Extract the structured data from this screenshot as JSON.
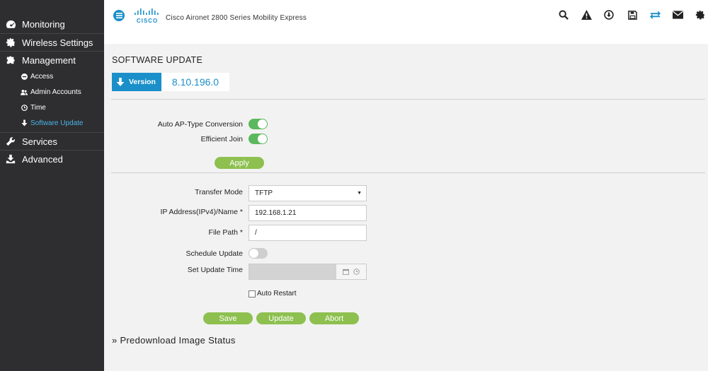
{
  "header": {
    "app_title": "Cisco Aironet 2800 Series Mobility Express",
    "logo_text": "CISCO",
    "icons": [
      "search-icon",
      "alert-icon",
      "download-icon",
      "save-icon",
      "transfer-icon",
      "mail-icon",
      "gear-icon"
    ]
  },
  "sidebar": {
    "items": [
      {
        "label": "Monitoring",
        "icon": "dashboard-icon"
      },
      {
        "label": "Wireless Settings",
        "icon": "gear-icon"
      },
      {
        "label": "Management",
        "icon": "puzzle-icon"
      },
      {
        "label": "Services",
        "icon": "wrench-icon"
      },
      {
        "label": "Advanced",
        "icon": "download-tray-icon"
      }
    ],
    "management_sub": [
      {
        "label": "Access",
        "icon": "minus-circle-icon"
      },
      {
        "label": "Admin Accounts",
        "icon": "users-icon"
      },
      {
        "label": "Time",
        "icon": "clock-icon"
      },
      {
        "label": "Software Update",
        "icon": "arrow-down-icon",
        "active": true
      }
    ]
  },
  "main": {
    "title": "SOFTWARE UPDATE",
    "version_label": "Version",
    "version_value": "8.10.196.0",
    "auto_ap_label": "Auto AP-Type Conversion",
    "auto_ap_on": true,
    "efficient_join_label": "Efficient Join",
    "efficient_join_on": true,
    "apply_label": "Apply",
    "transfer_mode_label": "Transfer Mode",
    "transfer_mode_value": "TFTP",
    "ip_label": "IP Address(IPv4)/Name *",
    "ip_value": "192.168.1.21",
    "file_path_label": "File Path *",
    "file_path_value": "/",
    "schedule_label": "Schedule Update",
    "schedule_on": false,
    "set_time_label": "Set Update Time",
    "auto_restart_label": "Auto Restart",
    "save_label": "Save",
    "update_label": "Update",
    "abort_label": "Abort",
    "predownload_label": "» Predownload Image Status"
  },
  "colors": {
    "accent": "#1a8fc9",
    "toggle_on": "#5cb85c",
    "button_green": "#8dc04f",
    "sidebar_bg": "#2e2e30"
  }
}
